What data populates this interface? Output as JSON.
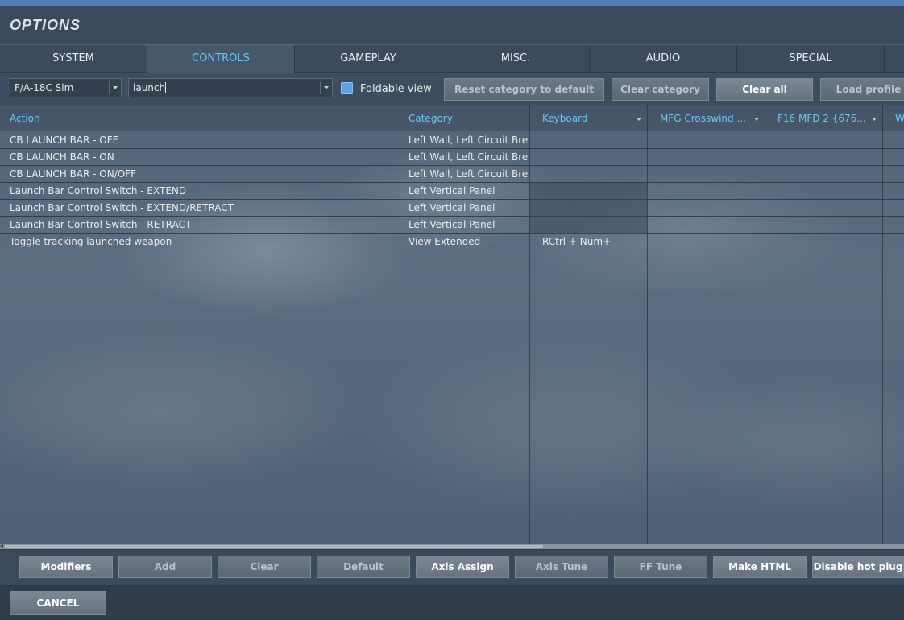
{
  "window": {
    "title": "OPTIONS"
  },
  "tabs": [
    {
      "label": "SYSTEM",
      "active": false
    },
    {
      "label": "CONTROLS",
      "active": true
    },
    {
      "label": "GAMEPLAY",
      "active": false
    },
    {
      "label": "MISC.",
      "active": false
    },
    {
      "label": "AUDIO",
      "active": false
    },
    {
      "label": "SPECIAL",
      "active": false
    }
  ],
  "toolbar": {
    "aircraft_select": "F/A-18C Sim",
    "search_value": "launch",
    "foldable_view_label": "Foldable view",
    "foldable_view_checked": true,
    "reset_category_label": "Reset category to default",
    "clear_category_label": "Clear category",
    "clear_all_label": "Clear all",
    "load_profile_label": "Load profile"
  },
  "table": {
    "columns": [
      "Action",
      "Category",
      "Keyboard",
      "MFG Crosswind ...",
      "F16 MFD 2 {676...",
      "W"
    ],
    "rows": [
      {
        "action": "CB LAUNCH BAR - OFF",
        "category": "Left Wall, Left Circuit Breaker Panel",
        "keyboard": ""
      },
      {
        "action": "CB LAUNCH BAR - ON",
        "category": "Left Wall, Left Circuit Breaker Panel",
        "keyboard": ""
      },
      {
        "action": "CB LAUNCH BAR - ON/OFF",
        "category": "Left Wall, Left Circuit Breaker Panel",
        "keyboard": ""
      },
      {
        "action": "Launch Bar Control Switch - EXTEND",
        "category": "Left Vertical Panel",
        "keyboard": ""
      },
      {
        "action": "Launch Bar Control Switch - EXTEND/RETRACT",
        "category": "Left Vertical Panel",
        "keyboard": ""
      },
      {
        "action": "Launch Bar Control Switch - RETRACT",
        "category": "Left Vertical Panel",
        "keyboard": ""
      },
      {
        "action": "Toggle tracking launched weapon",
        "category": "View Extended",
        "keyboard": "RCtrl + Num+"
      }
    ]
  },
  "bottom_buttons": {
    "modifiers": "Modifiers",
    "add": "Add",
    "clear": "Clear",
    "default": "Default",
    "axis_assign": "Axis Assign",
    "axis_tune": "Axis Tune",
    "ff_tune": "FF Tune",
    "make_html": "Make HTML",
    "disable_hot_plug": "Disable hot plug"
  },
  "footer": {
    "cancel_label": "CANCEL"
  },
  "colors": {
    "accent": "#6ec7ee",
    "checkbox": "#5aa2e4",
    "top_strip": "#4e7fb8"
  }
}
